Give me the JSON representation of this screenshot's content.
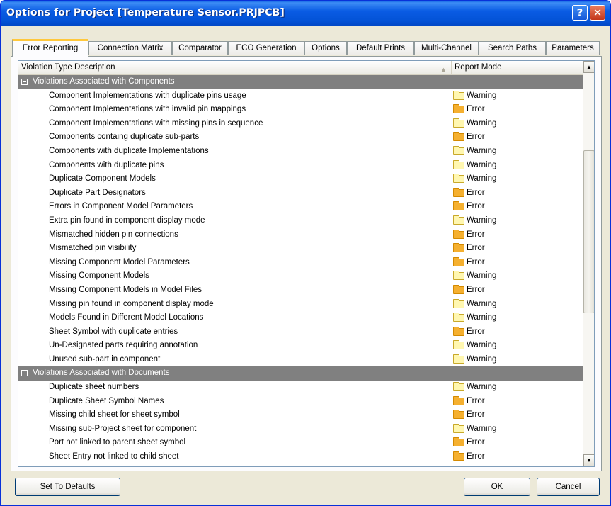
{
  "window": {
    "title": "Options for Project [Temperature Sensor.PRJPCB]",
    "help_glyph": "?",
    "close_glyph": "✕"
  },
  "tabs": [
    {
      "label": "Error Reporting",
      "active": true
    },
    {
      "label": "Connection Matrix"
    },
    {
      "label": "Comparator"
    },
    {
      "label": "ECO Generation"
    },
    {
      "label": "Options"
    },
    {
      "label": "Default Prints"
    },
    {
      "label": "Multi-Channel"
    },
    {
      "label": "Search Paths"
    },
    {
      "label": "Parameters"
    }
  ],
  "table": {
    "col_description": "Violation Type Description",
    "col_mode": "Report Mode",
    "sort_glyph": "▲"
  },
  "groups": [
    {
      "label": "Violations Associated with Components",
      "items": [
        {
          "label": "Component Implementations with duplicate pins usage",
          "mode": "Warning"
        },
        {
          "label": "Component Implementations with invalid pin mappings",
          "mode": "Error"
        },
        {
          "label": "Component Implementations with missing pins in sequence",
          "mode": "Warning"
        },
        {
          "label": "Components containg duplicate sub-parts",
          "mode": "Error"
        },
        {
          "label": "Components with duplicate Implementations",
          "mode": "Warning"
        },
        {
          "label": "Components with duplicate pins",
          "mode": "Warning"
        },
        {
          "label": "Duplicate Component Models",
          "mode": "Warning"
        },
        {
          "label": "Duplicate Part Designators",
          "mode": "Error"
        },
        {
          "label": "Errors in Component Model Parameters",
          "mode": "Error"
        },
        {
          "label": "Extra pin found in component display mode",
          "mode": "Warning"
        },
        {
          "label": "Mismatched hidden pin connections",
          "mode": "Error"
        },
        {
          "label": "Mismatched pin visibility",
          "mode": "Error"
        },
        {
          "label": "Missing Component Model Parameters",
          "mode": "Error"
        },
        {
          "label": "Missing Component Models",
          "mode": "Warning"
        },
        {
          "label": "Missing Component Models in Model Files",
          "mode": "Error"
        },
        {
          "label": "Missing pin found in component display mode",
          "mode": "Warning"
        },
        {
          "label": "Models Found in Different Model Locations",
          "mode": "Warning"
        },
        {
          "label": "Sheet Symbol with duplicate entries",
          "mode": "Error"
        },
        {
          "label": "Un-Designated parts requiring annotation",
          "mode": "Warning"
        },
        {
          "label": "Unused sub-part in component",
          "mode": "Warning"
        }
      ]
    },
    {
      "label": "Violations Associated with Documents",
      "items": [
        {
          "label": "Duplicate sheet numbers",
          "mode": "Warning"
        },
        {
          "label": "Duplicate Sheet Symbol Names",
          "mode": "Error"
        },
        {
          "label": "Missing child sheet for sheet symbol",
          "mode": "Error"
        },
        {
          "label": "Missing sub-Project sheet for component",
          "mode": "Warning"
        },
        {
          "label": "Port not linked to parent sheet symbol",
          "mode": "Error"
        },
        {
          "label": "Sheet Entry not linked to child sheet",
          "mode": "Error"
        }
      ]
    }
  ],
  "scrollbar": {
    "up_glyph": "▲",
    "down_glyph": "▼"
  },
  "buttons": {
    "defaults": "Set To Defaults",
    "ok": "OK",
    "cancel": "Cancel"
  }
}
